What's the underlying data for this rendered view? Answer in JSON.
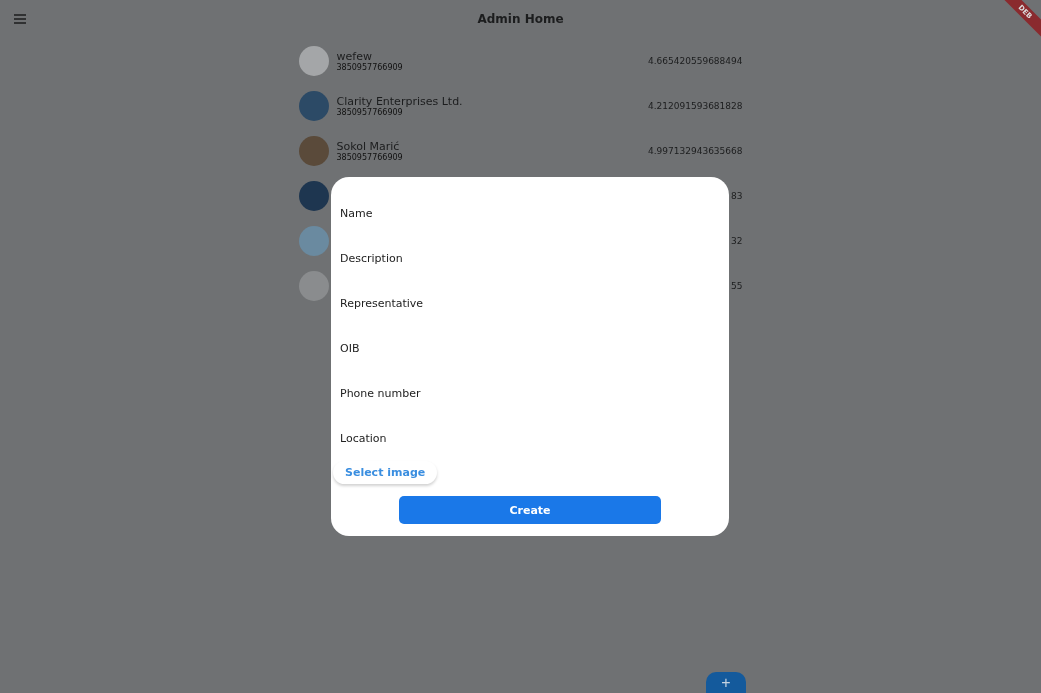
{
  "app_bar": {
    "title": "Admin Home",
    "debug_banner": "DEB"
  },
  "companies": [
    {
      "kind": "full",
      "name": "wefew",
      "phone": "3850957766909",
      "rating": "4.665420559688494"
    },
    {
      "kind": "full",
      "name": "Clarity Enterprises Ltd.",
      "phone": "3850957766909",
      "rating": "4.212091593681828"
    },
    {
      "kind": "full",
      "name": "Sokol Marić",
      "phone": "3850957766909",
      "rating": "4.997132943635668"
    },
    {
      "kind": "covered",
      "rating": "83"
    },
    {
      "kind": "covered",
      "rating": "32"
    },
    {
      "kind": "covered",
      "rating": "55"
    }
  ],
  "dialog": {
    "fields": [
      {
        "placeholder": "Name"
      },
      {
        "placeholder": "Description"
      },
      {
        "placeholder": "Representative"
      },
      {
        "placeholder": "OIB"
      },
      {
        "placeholder": "Phone number"
      },
      {
        "placeholder": "Location"
      }
    ],
    "select_image": "Select image",
    "submit": "Create"
  },
  "fab": "+"
}
